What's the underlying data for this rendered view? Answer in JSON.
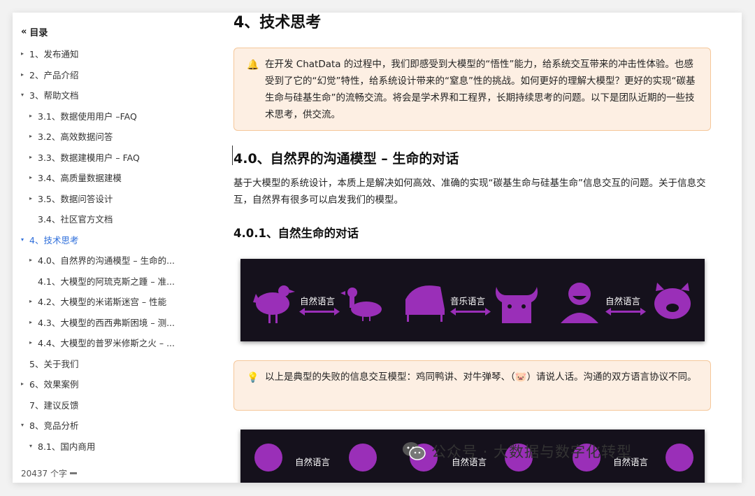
{
  "toc": {
    "title": "目录",
    "items": [
      {
        "label": "1、发布通知",
        "level": 1,
        "arrow": "▸",
        "active": false
      },
      {
        "label": "2、产品介绍",
        "level": 1,
        "arrow": "▸",
        "active": false
      },
      {
        "label": "3、帮助文档",
        "level": 1,
        "arrow": "▾",
        "active": false
      },
      {
        "label": "3.1、数据使用用户 –FAQ",
        "level": 2,
        "arrow": "▸",
        "active": false
      },
      {
        "label": "3.2、高效数据问答",
        "level": 2,
        "arrow": "▸",
        "active": false
      },
      {
        "label": "3.3、数据建模用户 – FAQ",
        "level": 2,
        "arrow": "▸",
        "active": false
      },
      {
        "label": "3.4、高质量数据建模",
        "level": 2,
        "arrow": "▸",
        "active": false
      },
      {
        "label": "3.5、数据问答设计",
        "level": 2,
        "arrow": "▸",
        "active": false
      },
      {
        "label": "3.4、社区官方文档",
        "level": 2,
        "arrow": "",
        "active": false
      },
      {
        "label": "4、技术思考",
        "level": 1,
        "arrow": "▾",
        "active": true
      },
      {
        "label": "4.0、自然界的沟通模型 – 生命的...",
        "level": 2,
        "arrow": "▸",
        "active": false
      },
      {
        "label": "4.1、大模型的阿琉克斯之踵 – 准...",
        "level": 2,
        "arrow": "",
        "active": false
      },
      {
        "label": "4.2、大模型的米诺斯迷宫 – 性能",
        "level": 2,
        "arrow": "▸",
        "active": false
      },
      {
        "label": "4.3、大模型的西西弗斯困境 – 测...",
        "level": 2,
        "arrow": "▸",
        "active": false
      },
      {
        "label": "4.4、大模型的普罗米修斯之火 – ...",
        "level": 2,
        "arrow": "▸",
        "active": false
      },
      {
        "label": "5、关于我们",
        "level": 1,
        "arrow": "",
        "active": false
      },
      {
        "label": "6、效果案例",
        "level": 1,
        "arrow": "▸",
        "active": false
      },
      {
        "label": "7、建议反馈",
        "level": 1,
        "arrow": "",
        "active": false
      },
      {
        "label": "8、竞品分析",
        "level": 1,
        "arrow": "▾",
        "active": false
      },
      {
        "label": "8.1、国内商用",
        "level": 2,
        "arrow": "▾",
        "active": false
      }
    ],
    "word_count": "20437 个字"
  },
  "doc": {
    "h1": "4、技术思考",
    "callout1_icon": "🔔",
    "callout1_text": "在开发 ChatData 的过程中，我们即感受到大模型的“悟性”能力，给系统交互带来的冲击性体验。也感受到了它的“幻觉”特性，给系统设计带来的“窒息”性的挑战。如何更好的理解大模型？更好的实现“碳基生命与硅基生命”的流畅交流。将会是学术界和工程界，长期持续思考的问题。以下是团队近期的一些技术思考，供交流。",
    "h2": "4.0、自然界的沟通模型 – 生命的对话",
    "paragraph": "基于大模型的系统设计，本质上是解决如何高效、准确的实现“碳基生命与硅基生命”信息交互的问题。关于信息交互，自然界有很多可以启发我们的模型。",
    "h3": "4.0.1、自然生命的对话",
    "image1_labels": [
      "自然语言",
      "音乐语言",
      "自然语言"
    ],
    "callout2_icon": "💡",
    "callout2_text": "以上是典型的失败的信息交互模型：鸡同鸭讲、对牛弹琴、（🐷）请说人话。沟通的双方语言协议不同。",
    "image2_labels": [
      "自然语言",
      "自然语言",
      "自然语言"
    ],
    "icon_color": "#9a2fb8"
  },
  "watermark": "公众号 · 大数据与数字化转型"
}
